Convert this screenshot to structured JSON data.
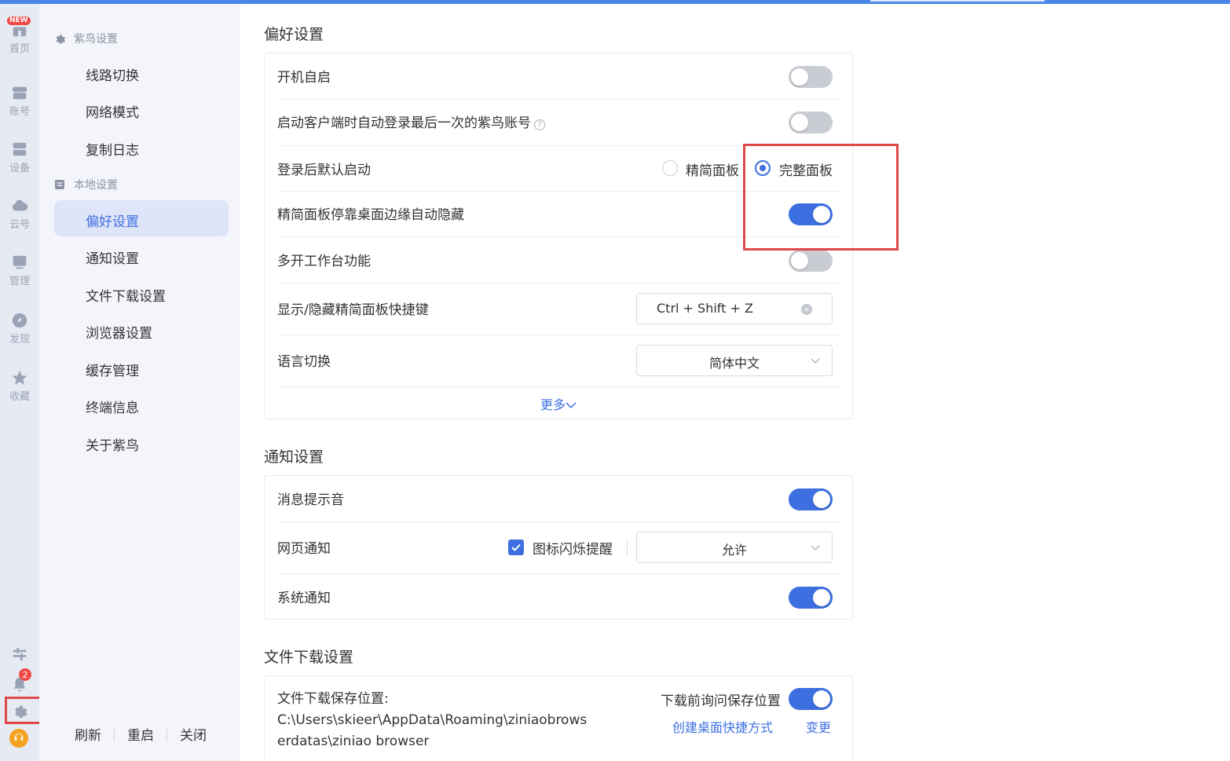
{
  "rail": {
    "items": [
      {
        "label": "首页",
        "badge": "NEW",
        "icon": "home-icon"
      },
      {
        "label": "账号",
        "icon": "account-icon"
      },
      {
        "label": "设备",
        "icon": "device-icon"
      },
      {
        "label": "云号",
        "icon": "cloud-icon"
      },
      {
        "label": "管理",
        "icon": "manage-icon"
      },
      {
        "label": "发现",
        "icon": "compass-icon"
      },
      {
        "label": "收藏",
        "icon": "star-icon"
      }
    ],
    "notification_count": "2"
  },
  "sidebar": {
    "group1": "紫鸟设置",
    "group1_items": [
      "线路切换",
      "网络模式",
      "复制日志"
    ],
    "group2": "本地设置",
    "group2_items": [
      "偏好设置",
      "通知设置",
      "文件下载设置",
      "浏览器设置",
      "缓存管理",
      "终端信息",
      "关于紫鸟"
    ],
    "footer": {
      "refresh": "刷新",
      "restart": "重启",
      "close": "关闭"
    }
  },
  "preferences": {
    "title": "偏好设置",
    "autostart": {
      "label": "开机自启",
      "on": false
    },
    "autologin": {
      "label": "启动客户端时自动登录最后一次的紫鸟账号",
      "on": false
    },
    "default_launch": {
      "label": "登录后默认启动",
      "option1": "精简面板",
      "option2": "完整面板",
      "selected": "完整面板"
    },
    "auto_hide": {
      "label": "精简面板停靠桌面边缘自动隐藏",
      "on": true
    },
    "multi_workspace": {
      "label": "多开工作台功能",
      "on": false
    },
    "hotkey": {
      "label": "显示/隐藏精简面板快捷键",
      "value": "Ctrl + Shift + Z"
    },
    "language": {
      "label": "语言切换",
      "value": "简体中文"
    },
    "more": "更多"
  },
  "notifications": {
    "title": "通知设置",
    "sound": {
      "label": "消息提示音",
      "on": true
    },
    "web": {
      "label": "网页通知",
      "checkbox_label": "图标闪烁提醒",
      "value": "允许"
    },
    "system": {
      "label": "系统通知",
      "on": true
    }
  },
  "downloads": {
    "title": "文件下载设置",
    "path_label": "文件下载保存位置:",
    "path_line1": "C:\\Users\\skieer\\AppData\\Roaming\\ziniaobrows",
    "path_line2": "erdatas\\ziniao browser",
    "ask_label": "下载前询问保存位置",
    "ask_on": true,
    "shortcut_link": "创建桌面快捷方式",
    "change_link": "变更"
  },
  "colors": {
    "accent": "#3d6fe0",
    "highlight": "#e04848",
    "rail_bg": "#e6eaf3",
    "sidebar_bg": "#f3f5fb"
  }
}
